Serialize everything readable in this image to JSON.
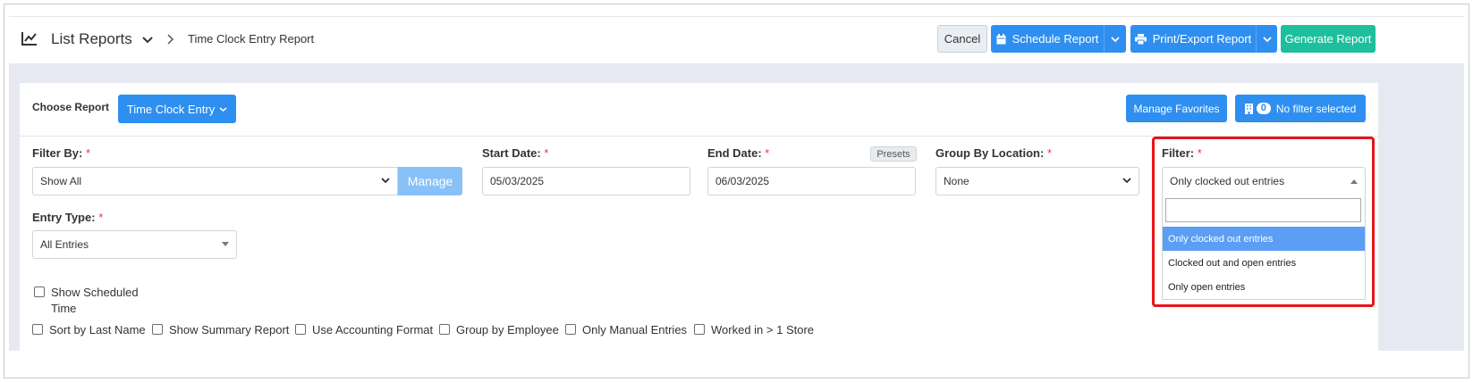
{
  "header": {
    "title": "List Reports",
    "breadcrumb": "Time Clock Entry Report",
    "cancel_label": "Cancel",
    "schedule_label": "Schedule Report",
    "print_label": "Print/Export Report",
    "generate_label": "Generate Report"
  },
  "report": {
    "choose_label": "Choose Report",
    "selected": "Time Clock Entry",
    "favorites_label": "Manage Favorites",
    "filter_count": "0",
    "no_filter_label": "No filter selected"
  },
  "form": {
    "filter_by": {
      "label": "Filter By:",
      "required": "*",
      "value": "Show All",
      "manage_label": "Manage"
    },
    "start_date": {
      "label": "Start Date:",
      "required": "*",
      "value": "05/03/2025"
    },
    "end_date": {
      "label": "End Date:",
      "required": "*",
      "value": "06/03/2025",
      "presets_label": "Presets"
    },
    "group_by": {
      "label": "Group By Location:",
      "required": "*",
      "value": "None"
    },
    "filter": {
      "label": "Filter:",
      "required": "*",
      "value": "Only clocked out entries",
      "search_value": "",
      "options": [
        "Only clocked out entries",
        "Clocked out and open entries",
        "Only open entries"
      ],
      "selected_index": 0
    },
    "entry_type": {
      "label": "Entry Type:",
      "required": "*",
      "value": "All Entries"
    }
  },
  "checkboxes": {
    "show_scheduled_line1": "Show Scheduled",
    "show_scheduled_line2": "Time",
    "sort_last_name": "Sort by Last Name",
    "summary": "Show Summary Report",
    "accounting": "Use Accounting Format",
    "group_employee": "Group by Employee",
    "manual_entries": "Only Manual Entries",
    "worked_store": "Worked in > 1 Store"
  },
  "colors": {
    "primary": "#2e8ff0",
    "success": "#1dbf9c",
    "highlight": "#e8141b",
    "selected_option": "#5b9ef4"
  }
}
